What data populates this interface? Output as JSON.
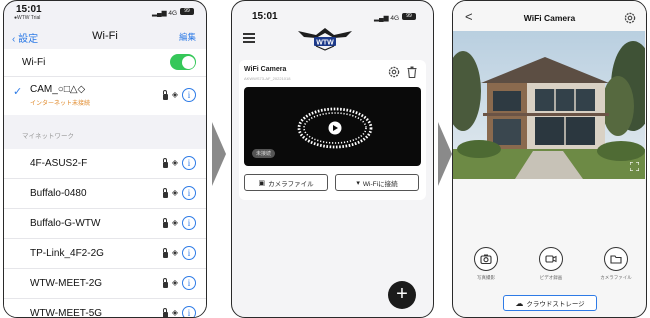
{
  "colors": {
    "accent_blue": "#2e7be6",
    "toggle_green": "#35c759",
    "warning_orange": "#e0892a",
    "arrow_gray": "#8a8a8a"
  },
  "wifi_settings": {
    "time": "15:01",
    "carrier": "●WTW Trial",
    "signal": "4G",
    "battery": "99",
    "back_label": "設定",
    "title": "Wi-Fi",
    "edit_label": "編集",
    "wifi_label": "Wi-Fi",
    "wifi_enabled": true,
    "connected_network": "CAM_○□△◇",
    "connected_status": "インターネット未接続",
    "section_label": "マイネットワーク",
    "networks": [
      "4F-ASUS2-F",
      "Buffalo-0480",
      "Buffalo-G-WTW",
      "TP-Link_4F2-2G",
      "WTW-MEET-2G",
      "WTW-MEET-5G"
    ]
  },
  "app_home": {
    "time": "15:01",
    "signal": "4G",
    "battery": "99",
    "logo_text": "WTW",
    "camera_name": "WiFi Camera",
    "camera_id": "AKWWS73-AF_20221018",
    "offline_label": "未接続",
    "files_button": "カメラファイル",
    "wifi_button": "Wi-Fiに接続",
    "add_button": "+"
  },
  "camera_view": {
    "back_label": "<",
    "title": "WiFi Camera",
    "controls": [
      {
        "label": "写真撮影",
        "icon": "camera-icon"
      },
      {
        "label": "ビデオ録画",
        "icon": "video-icon"
      },
      {
        "label": "カメラファイル",
        "icon": "folder-icon"
      }
    ],
    "cloud_button": "クラウドストレージ"
  }
}
